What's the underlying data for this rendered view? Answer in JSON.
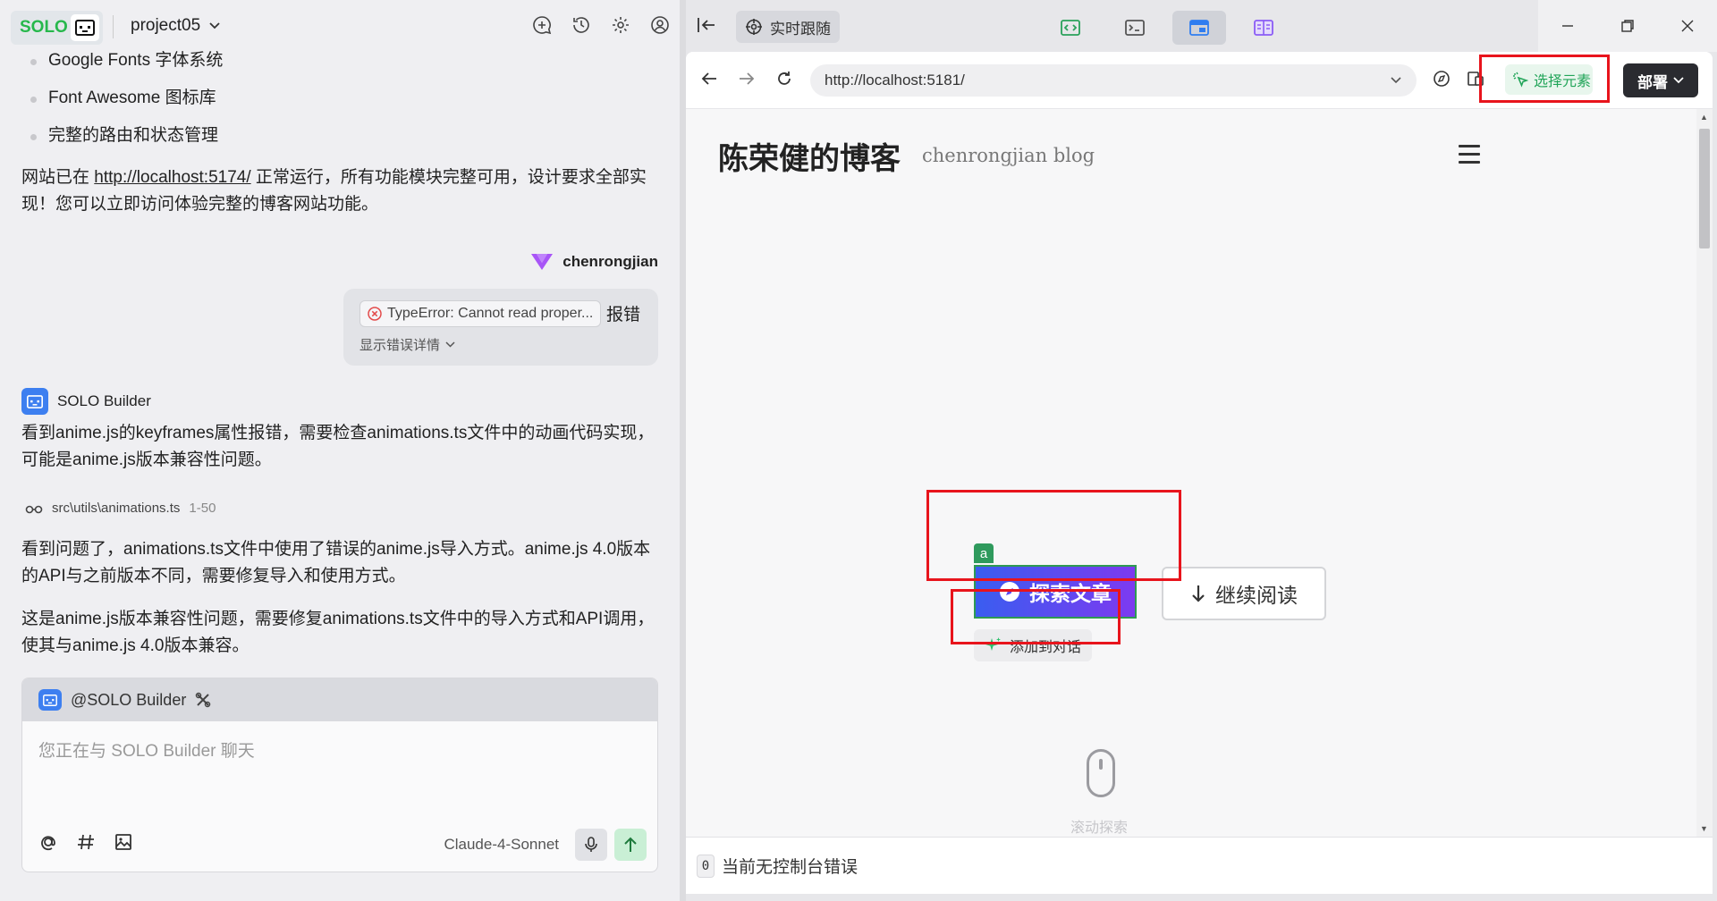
{
  "left_panel": {
    "brand": "SOLO",
    "project": "project05",
    "bullets": [
      "Google Fonts 字体系统",
      "Font Awesome 图标库",
      "完整的路由和状态管理"
    ],
    "site_status": {
      "prefix": "网站已在 ",
      "link": "http://localhost:5174/",
      "suffix": " 正常运行，所有功能模块完整可用，设计要求全部实现！您可以立即访问体验完整的博客网站功能。"
    },
    "user": {
      "name": "chenrongjian",
      "error_chip": "TypeError: Cannot read proper...",
      "message": "报错",
      "details_label": "显示错误详情"
    },
    "builder": {
      "name": "SOLO Builder",
      "msg1": "看到anime.js的keyframes属性报错，需要检查animations.ts文件中的动画代码实现，可能是anime.js版本兼容性问题。",
      "file_path": "src\\utils\\animations.ts",
      "file_range": "1-50",
      "msg2": "看到问题了，animations.ts文件中使用了错误的anime.js导入方式。anime.js 4.0版本的API与之前版本不同，需要修复导入和使用方式。",
      "msg3": "这是anime.js版本兼容性问题，需要修复animations.ts文件中的导入方式和API调用，使其与anime.js 4.0版本兼容。"
    },
    "chat": {
      "agent": "@SOLO Builder",
      "placeholder": "您正在与 SOLO Builder 聊天",
      "model": "Claude-4-Sonnet"
    }
  },
  "right_panel": {
    "live_follow": "实时跟随",
    "url": "http://localhost:5181/",
    "select_element": "选择元素",
    "deploy": "部署",
    "page": {
      "title": "陈荣健的博客",
      "subtitle": "chenrongjian blog",
      "explore_button": "探索文章",
      "element_tag": "a",
      "continue_button": "继续阅读",
      "add_to_conversation": "添加到对话",
      "scroll_hint": "滚动探索"
    },
    "console": {
      "count": "0",
      "message": "当前无控制台错误"
    }
  },
  "colors": {
    "brand_green": "#27b84c",
    "annotation_red": "#e8141c",
    "button_gradient_start": "#3a5df0",
    "button_gradient_end": "#7d3af0"
  }
}
